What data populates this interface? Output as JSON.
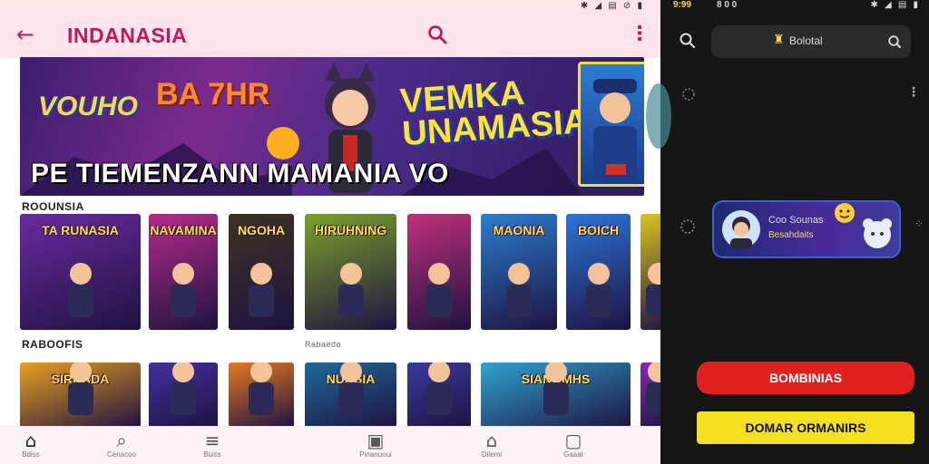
{
  "left": {
    "status_icons": "✱ ◢ ▤ ⊘ ▮",
    "appbar": {
      "back": "←",
      "title": "INDANASIA",
      "more": "⋮"
    },
    "banner": {
      "logo_left": "VOUHO",
      "logo_mid": "BA 7HR",
      "headline": "VEMKA UNAMASIA",
      "tagline": "PE TIEMENZANN MAMANIA VO"
    },
    "section1": {
      "label": "ROOUNSIA"
    },
    "section2": {
      "label": "RABOOFIS",
      "side": "Rabaedo"
    },
    "row1": [
      {
        "title": "TA RUNASIA",
        "bg": "#6a2aa0"
      },
      {
        "title": "NAVAMINA",
        "bg": "#b62b8a"
      },
      {
        "title": "NGOHA",
        "bg": "#3d3322"
      },
      {
        "title": "HIRUHNING",
        "bg": "#7aa22a"
      },
      {
        "title": "",
        "bg": "#c0307a"
      },
      {
        "title": "MAONIA",
        "bg": "#2a7ed0"
      },
      {
        "title": "BOICH",
        "bg": "#2a76d8"
      },
      {
        "title": "",
        "bg": "#d9c51e"
      }
    ],
    "row2": [
      {
        "title": "SIRDADA",
        "bg": "#e8a020"
      },
      {
        "title": "",
        "bg": "#4430a0"
      },
      {
        "title": "",
        "bg": "#e47a20"
      },
      {
        "title": "NUASIA",
        "bg": "#1e6a9a"
      },
      {
        "title": "",
        "bg": "#3a3aa0"
      },
      {
        "title": "SIANOMHS",
        "bg": "#2fa3d0"
      },
      {
        "title": "",
        "bg": "#8a2ab0"
      }
    ],
    "nav": [
      {
        "label": "Bdiss",
        "icon": "⌂"
      },
      {
        "label": "Cenacoo",
        "icon": "⌕"
      },
      {
        "label": "Buiss",
        "icon": "≡"
      },
      {
        "label": "Pinanuoui",
        "icon": "▣"
      },
      {
        "label": "Dilemi",
        "icon": "⌂"
      },
      {
        "label": "Gaaat",
        "icon": "▢"
      }
    ]
  },
  "right": {
    "status_time": "9:99",
    "status_extra": "8 0 0",
    "status_icons": "✱ ◢ ▤ ▮",
    "search_text": "Bolotal",
    "pill": {
      "name": "Coo Sounas",
      "sub": "Besahdaits"
    },
    "btn_red": "BOMBINIAS",
    "btn_yellow": "DOMAR ORMANIRS",
    "colors": {
      "red": "#e0201e",
      "yellow": "#f5e020"
    }
  }
}
